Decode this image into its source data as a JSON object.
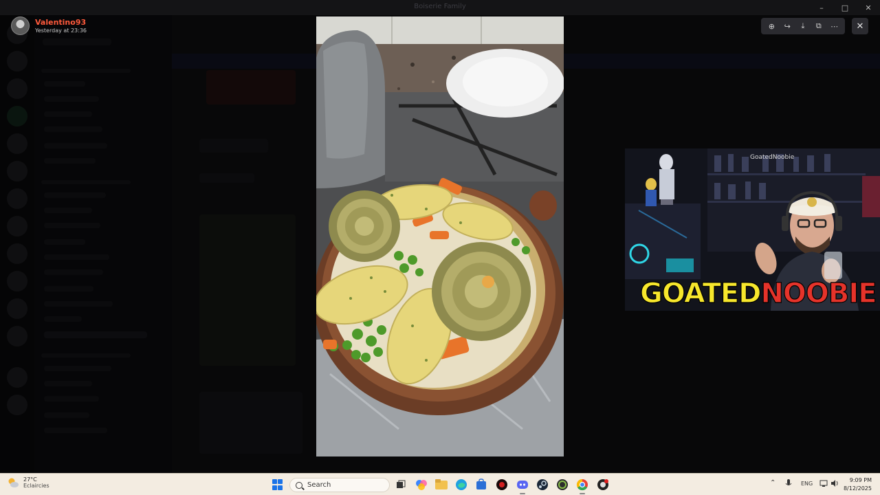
{
  "window": {
    "title": "Boiserie Family",
    "controls": [
      "–",
      "□",
      "✕"
    ]
  },
  "viewer": {
    "author_name": "Valentino93",
    "timestamp": "Yesterday at 23:36",
    "toolbar": [
      {
        "name": "zoom-icon",
        "glyph": "⊕"
      },
      {
        "name": "forward-icon",
        "glyph": "↪"
      },
      {
        "name": "download-icon",
        "glyph": "⤓"
      },
      {
        "name": "open-external-icon",
        "glyph": "⧉"
      },
      {
        "name": "more-icon",
        "glyph": "⋯"
      }
    ],
    "close_glyph": "✕"
  },
  "webcam": {
    "logo_part1": "GOATED",
    "logo_part2": "NOOBIE",
    "overlay_tag": "GoatedNoobie"
  },
  "taskbar": {
    "weather_temp": "27°C",
    "weather_desc": "Eclaircies",
    "search_placeholder": "Search",
    "language": "ENG",
    "time": "9:09 PM",
    "date": "8/12/2025"
  },
  "colors": {
    "author": "#ff5a3c",
    "logo_yellow": "#f7e72c",
    "logo_red": "#e5332a",
    "taskbar_bg": "#f3ece1"
  }
}
